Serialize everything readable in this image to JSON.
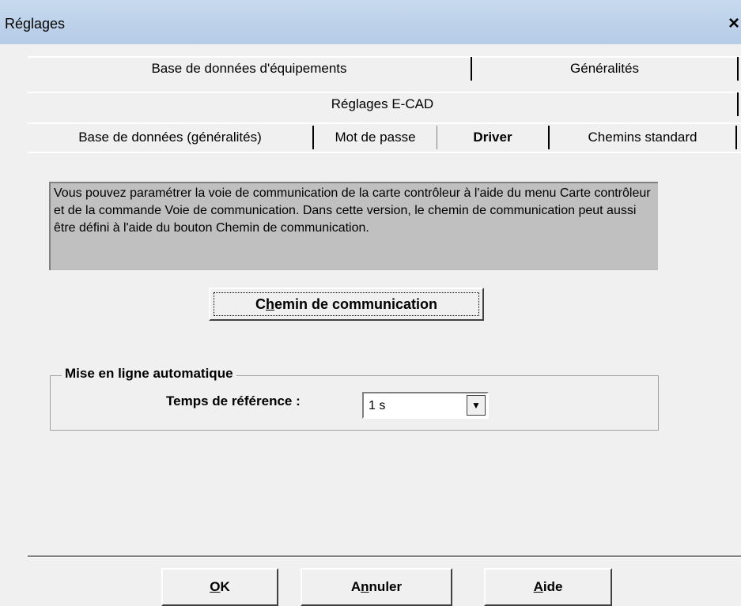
{
  "window": {
    "title": "Réglages",
    "close": "×"
  },
  "tabs": {
    "row1": [
      "Base de données d'équipements",
      "Généralités"
    ],
    "row2": [
      "Réglages E-CAD"
    ],
    "row3": [
      "Base de données (généralités)",
      "Mot de passe",
      "Driver",
      "Chemins standard"
    ],
    "active": "Driver"
  },
  "info_text": "Vous pouvez paramétrer la voie de communication de la carte contrôleur à l'aide du menu Carte contrôleur et de la commande Voie de communication. Dans cette version, le chemin de communication peut aussi être défini à l'aide du bouton Chemin de communication.",
  "comm_button": {
    "prefix": "C",
    "hotkey": "h",
    "rest": "emin de communication"
  },
  "auto_online": {
    "legend": "Mise en ligne automatique",
    "label": "Temps de référence :",
    "value": "1 s",
    "arrow": "▼"
  },
  "footer": {
    "ok": {
      "hotkey": "O",
      "rest": "K"
    },
    "cancel": {
      "prefix": "A",
      "hotkey": "n",
      "rest": "nuler"
    },
    "help": {
      "hotkey": "A",
      "rest": "ide"
    }
  }
}
